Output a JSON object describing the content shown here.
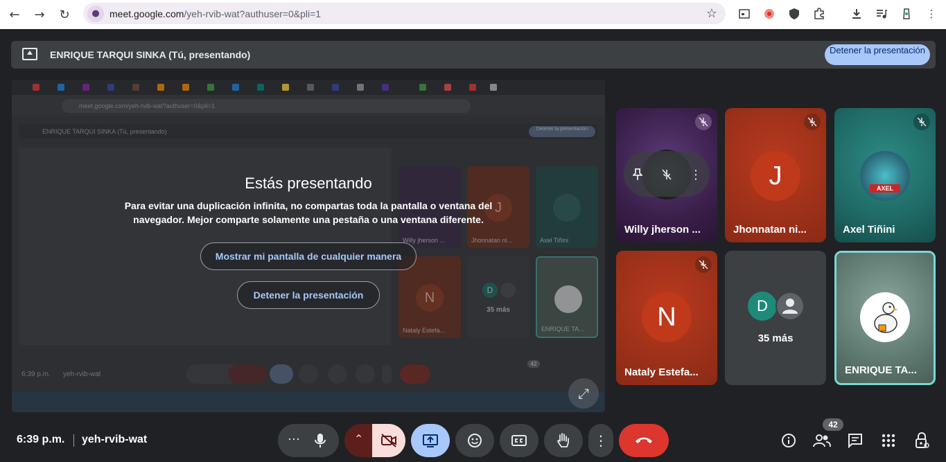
{
  "browser": {
    "url_host": "meet.google.com",
    "url_path": "/yeh-rvib-wat?authuser=0&pli=1"
  },
  "banner": {
    "presenter_text": "ENRIQUE TARQUI SINKA (Tú, presentando)",
    "stop_label": "Detener la presentación"
  },
  "preview": {
    "url": "meet.google.com/yeh-rvib-wat?authuser=0&pli=1",
    "banner_text": "ENRIQUE TARQUI SINKA (Tú, presentando)",
    "stop_label": "Detener la presentación",
    "time": "6:39 p.m.",
    "code": "yeh-rvib-wat",
    "badge": "42",
    "tiles": [
      {
        "label": "Willy jherson ..."
      },
      {
        "label": "Jhonnatan ni...",
        "initial": "J"
      },
      {
        "label": "Axel Tiñini"
      },
      {
        "label": "Nataly Estefa...",
        "initial": "N"
      },
      {
        "label": "35 más",
        "d": "D"
      },
      {
        "label": "ENRIQUE TA..."
      }
    ]
  },
  "overlay": {
    "title": "Estás presentando",
    "message": "Para evitar una duplicación infinita, no compartas toda la pantalla o ventana del navegador. Mejor comparte solamente una pestaña o una ventana diferente.",
    "show_anyway": "Mostrar mi pantalla de cualquier manera",
    "stop": "Detener la presentación"
  },
  "participants": [
    {
      "name": "Willy jherson ...",
      "color": "#3a1f4a"
    },
    {
      "name": "Jhonnatan ni...",
      "initial": "J",
      "color": "#a8321c"
    },
    {
      "name": "Axel Tiñini",
      "color": "#1f6a66"
    },
    {
      "name": "Nataly Estefa...",
      "initial": "N",
      "color": "#a8321c"
    },
    {
      "name": "35 más",
      "initial": "D"
    },
    {
      "name": "ENRIQUE TA...",
      "color": "#5f7a70"
    }
  ],
  "axel_avatar_text": "AXEL",
  "bottom": {
    "time": "6:39 p.m.",
    "meeting_code": "yeh-rvib-wat",
    "participant_count": "42"
  },
  "colors": {
    "accent": "#a8c7fa",
    "end_call": "#dc362e",
    "camera_off": "#f9dedc"
  }
}
